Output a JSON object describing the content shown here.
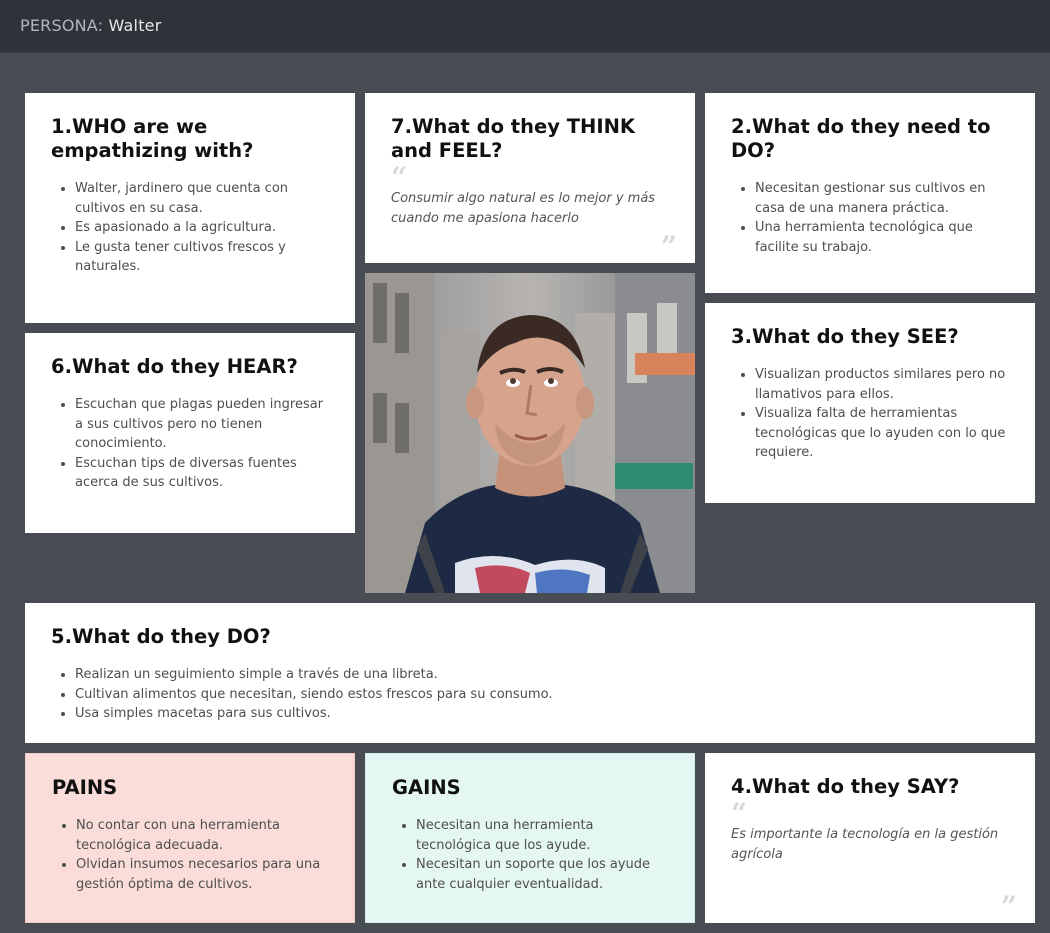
{
  "header": {
    "prefix": "PERSONA:",
    "name": "Walter"
  },
  "cards": {
    "who": {
      "title": "1.WHO are we empathizing with?",
      "items": [
        "Walter, jardinero que cuenta con cultivos en su casa.",
        "Es apasionado a la agricultura.",
        "Le gusta tener cultivos frescos y naturales."
      ]
    },
    "think": {
      "title": "7.What do they THINK and FEEL?",
      "quote": "Consumir algo natural es lo mejor  y más cuando me apasiona hacerlo"
    },
    "need": {
      "title": "2.What do they need to DO?",
      "items": [
        "Necesitan gestionar sus cultivos en casa de una manera práctica.",
        "Una herramienta tecnológica que facilite su trabajo."
      ]
    },
    "hear": {
      "title": "6.What do they HEAR?",
      "items": [
        "Escuchan que plagas pueden ingresar a sus cultivos pero no tienen conocimiento.",
        "Escuchan tips de diversas fuentes acerca de sus cultivos."
      ]
    },
    "see": {
      "title": "3.What do they SEE?",
      "items": [
        "Visualizan productos similares pero no llamativos para ellos.",
        "Visualiza falta de herramientas tecnológicas que lo ayuden con lo que requiere."
      ]
    },
    "do": {
      "title": "5.What do they DO?",
      "items": [
        "Realizan un seguimiento simple a través de una libreta.",
        "Cultivan alimentos que necesitan, siendo estos frescos para su consumo.",
        "Usa simples macetas para sus cultivos."
      ]
    },
    "pains": {
      "title": "PAINS",
      "items": [
        "No contar con una herramienta tecnológica adecuada.",
        "Olvidan insumos necesarios para una gestión óptima de cultivos."
      ]
    },
    "gains": {
      "title": "GAINS",
      "items": [
        "Necesitan una herramienta tecnológica que los ayude.",
        "Necesitan un soporte que los ayude ante cualquier eventualidad."
      ]
    },
    "say": {
      "title": "4.What do they SAY?",
      "quote": "Es importante la tecnología en la gestión agrícola"
    }
  },
  "photo": {
    "icon": "persona-photo"
  },
  "colors": {
    "background": "#484c53",
    "header": "#2f3238",
    "card": "#ffffff",
    "pains": "#fadcd9",
    "gains": "#e5f7f3"
  }
}
